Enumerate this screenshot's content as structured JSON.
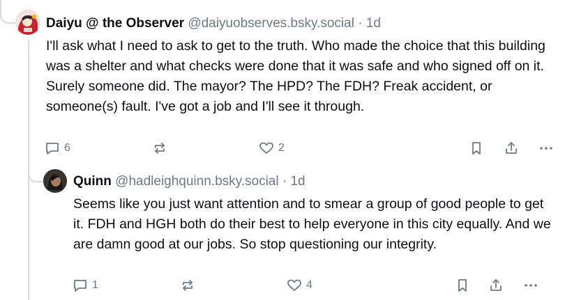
{
  "posts": [
    {
      "display_name": "Daiyu @ the Observer",
      "handle": "@daiyuobserves.bsky.social",
      "separator": "·",
      "time": "1d",
      "text": "I'll ask what I need to ask to get to the truth. Who made the choice that this building was a shelter and what checks were done that it was safe and who signed off on it. Surely someone did. The mayor? The HPD? The FDH? Freak accident, or someone(s) fault. I've got a job and I'll see it through.",
      "reply_count": "6",
      "like_count": "2"
    },
    {
      "display_name": "Quinn",
      "handle": "@hadleighquinn.bsky.social",
      "separator": "·",
      "time": "1d",
      "text": "Seems like you just want attention and to smear a group of good people to get it. FDH and HGH both do their best to help everyone in this city equally. And we are damn good at our jobs. So stop questioning our integrity.",
      "reply_count": "1",
      "like_count": "4"
    }
  ],
  "icons": {
    "reply": "speech-bubble-icon",
    "repost": "repost-arrows-icon",
    "like": "heart-icon",
    "bookmark": "bookmark-icon",
    "share": "share-upload-icon",
    "more": "ellipsis-icon"
  },
  "colors": {
    "text": "#0b0f14",
    "muted": "#6b7a8a",
    "thread_line": "#d4dbe2"
  }
}
